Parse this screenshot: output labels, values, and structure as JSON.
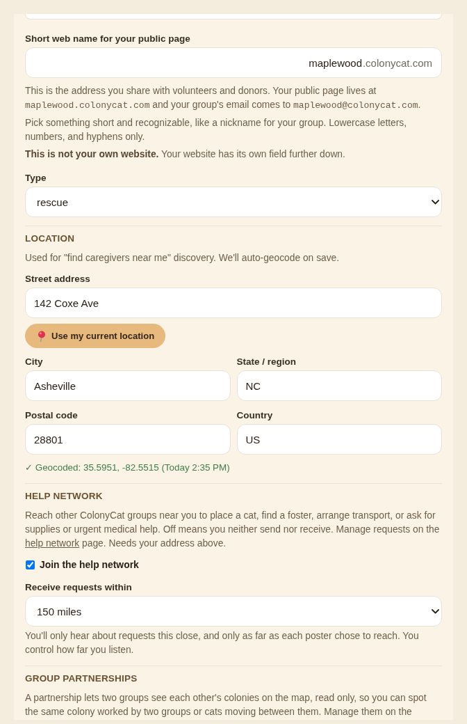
{
  "top_field": {
    "kind": "cut_field"
  },
  "public_page": {
    "label": "Short web name for your public page",
    "value": "maplewood",
    "suffix": ".colonycat.com",
    "help": [
      [
        {
          "kind": "text",
          "text": "This is the address you share with volunteers and donors. Your public page lives at "
        },
        {
          "kind": "code",
          "text": "maplewood.colonycat.com"
        },
        {
          "kind": "text",
          "text": " and your group's email comes to "
        },
        {
          "kind": "code",
          "text": "maplewood@colonycat.com"
        },
        {
          "kind": "text",
          "text": "."
        }
      ],
      [
        {
          "kind": "text",
          "text": "Pick something short and recognizable, like a nickname for your group. Lowercase letters, numbers, and hyphens only."
        }
      ],
      [
        {
          "kind": "text",
          "text": "**This is not your own website.** Your website has its own field further down."
        }
      ]
    ]
  },
  "type": {
    "label": "Type",
    "value": "rescue"
  },
  "location": {
    "heading": "LOCATION",
    "description": "Used for \"find caregivers near me\" discovery. We'll auto-geocode on save.",
    "street": {
      "label": "Street address",
      "value": "142 Coxe Ave"
    },
    "locate_button": "Use my current location",
    "fields": [
      {
        "label": "City",
        "value": "Asheville"
      },
      {
        "label": "State / region",
        "value": "NC"
      },
      {
        "label": "Postal code",
        "value": "28801"
      },
      {
        "label": "Country",
        "value": "US"
      }
    ],
    "geocode_status": "✓ Geocoded: 35.5951, -82.5515 (Today 2:35 PM)"
  },
  "help_network": {
    "heading": "HELP NETWORK",
    "description": [
      {
        "kind": "text",
        "text": "Reach other ColonyCat groups near you to place a cat, find a foster, arrange transport, or ask for supplies or urgent medical help. Off means you neither send nor receive. Manage requests on the "
      },
      {
        "kind": "link",
        "text": "help network"
      },
      {
        "kind": "text",
        "text": " page. Needs your address above."
      }
    ],
    "join": {
      "label": "Join the help network",
      "checked": true
    },
    "radius": {
      "label": "Receive requests within",
      "value": "150 miles"
    },
    "note": "You'll only hear about requests this close, and only as far as each poster chose to reach. You control how far you listen."
  },
  "group_partnerships": {
    "heading": "GROUP PARTNERSHIPS",
    "description": "A partnership lets two groups see each other's colonies on the map, read only, so you can spot the same colony worked by two groups or cats moving between them. Manage them on the"
  }
}
